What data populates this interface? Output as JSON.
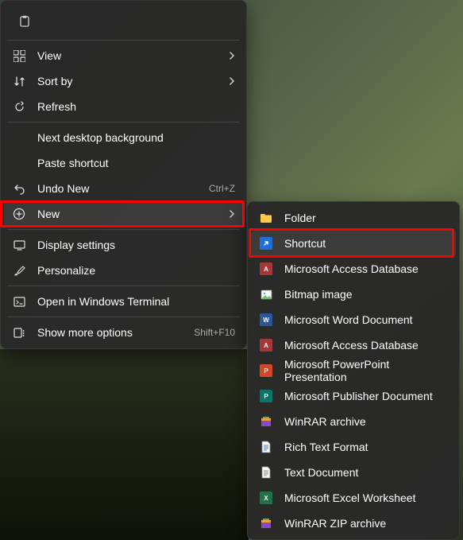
{
  "main_menu": {
    "view": "View",
    "sort_by": "Sort by",
    "refresh": "Refresh",
    "next_bg": "Next desktop background",
    "paste_shortcut": "Paste shortcut",
    "undo_new": "Undo New",
    "undo_shortcut": "Ctrl+Z",
    "new": "New",
    "display_settings": "Display settings",
    "personalize": "Personalize",
    "open_terminal": "Open in Windows Terminal",
    "show_more": "Show more options",
    "show_more_shortcut": "Shift+F10"
  },
  "submenu": {
    "folder": "Folder",
    "shortcut": "Shortcut",
    "access_db": "Microsoft Access Database",
    "bitmap": "Bitmap image",
    "word_doc": "Microsoft Word Document",
    "access_db2": "Microsoft Access Database",
    "ppt": "Microsoft PowerPoint Presentation",
    "publisher": "Microsoft Publisher Document",
    "winrar": "WinRAR archive",
    "rtf": "Rich Text Format",
    "txt": "Text Document",
    "excel": "Microsoft Excel Worksheet",
    "winrar_zip": "WinRAR ZIP archive"
  }
}
